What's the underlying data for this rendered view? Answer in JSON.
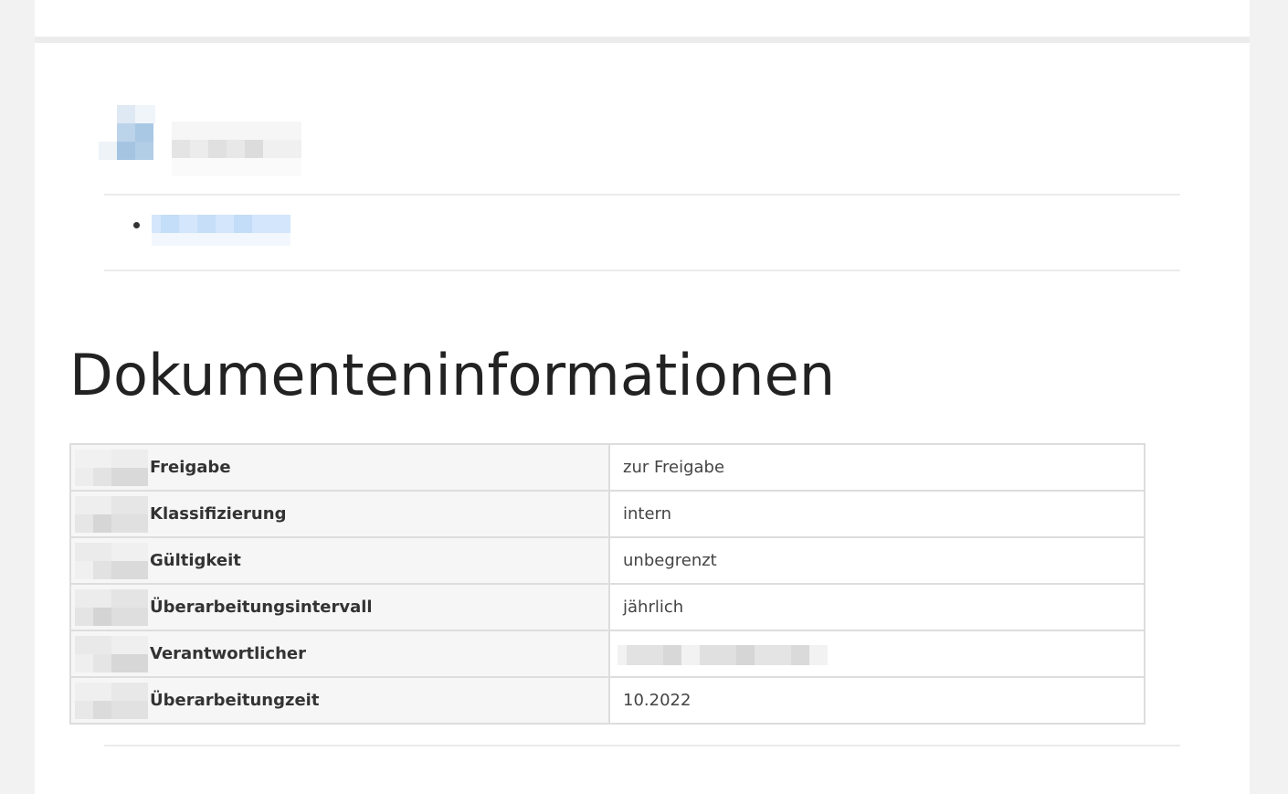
{
  "heading": "Dokumenteninformationen",
  "colors": {
    "page_bg": "#ffffff",
    "frame_bg": "#f2f2f2",
    "table_key_bg": "#f6f6f6",
    "border": "#dddddd",
    "link_redaction": "#cde3fa",
    "logo_redaction": "#a9c8e4"
  },
  "icons": {
    "logo": "company-logo-icon",
    "row_icon": "status-emoji-icon"
  },
  "document_info": [
    {
      "key": "Freigabe",
      "value": "zur Freigabe"
    },
    {
      "key": "Klassifizierung",
      "value": "intern"
    },
    {
      "key": "Gültigkeit",
      "value": "unbegrenzt"
    },
    {
      "key": "Überarbeitungsintervall",
      "value": "jährlich"
    },
    {
      "key": "Verantwortlicher",
      "value": ""
    },
    {
      "key": "Überarbeitungzeit",
      "value": "10.2022"
    }
  ]
}
